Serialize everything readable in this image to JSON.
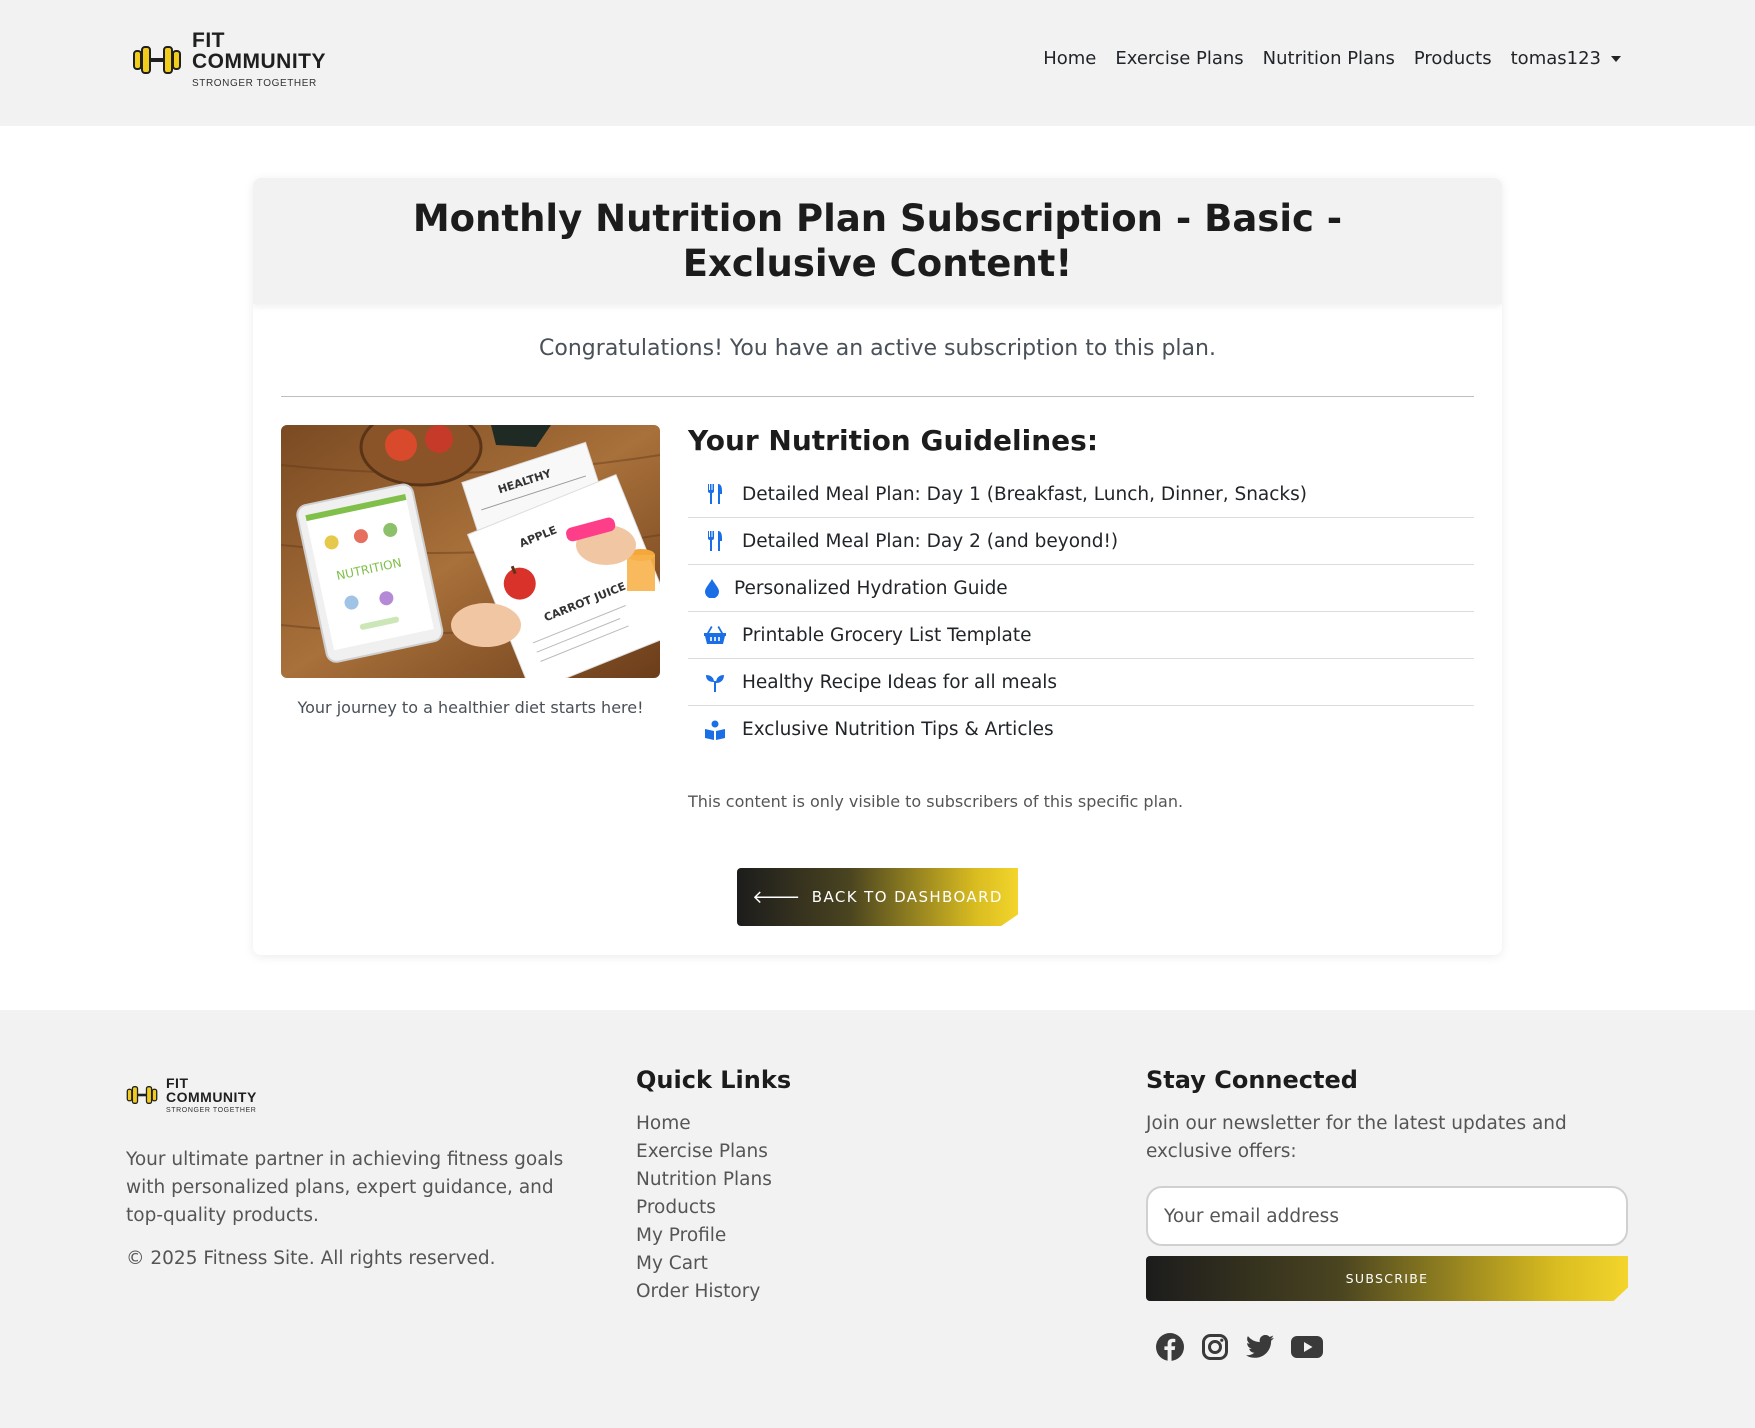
{
  "brand": {
    "line1": "FIT",
    "line2": "COMMUNITY",
    "tagline": "STRONGER TOGETHER",
    "accent": "#f2cc1c"
  },
  "nav": {
    "items": [
      {
        "label": "Home"
      },
      {
        "label": "Exercise Plans"
      },
      {
        "label": "Nutrition Plans"
      },
      {
        "label": "Products"
      }
    ],
    "user": "tomas123"
  },
  "plan": {
    "title": "Monthly Nutrition Plan Subscription - Basic - Exclusive Content!",
    "status_message": "Congratulations! You have an active subscription to this plan.",
    "image_caption": "Your journey to a healthier diet starts here!",
    "guidelines_title": "Your Nutrition Guidelines:",
    "guidelines": [
      {
        "icon": "utensils-icon",
        "label": "Detailed Meal Plan: Day 1 (Breakfast, Lunch, Dinner, Snacks)"
      },
      {
        "icon": "utensils-icon",
        "label": "Detailed Meal Plan: Day 2 (and beyond!)"
      },
      {
        "icon": "droplet-icon",
        "label": "Personalized Hydration Guide"
      },
      {
        "icon": "basket-icon",
        "label": "Printable Grocery List Template"
      },
      {
        "icon": "seedling-icon",
        "label": "Healthy Recipe Ideas for all meals"
      },
      {
        "icon": "book-reader-icon",
        "label": "Exclusive Nutrition Tips & Articles"
      }
    ],
    "note": "This content is only visible to subscribers of this specific plan.",
    "back_button": "BACK TO DASHBOARD",
    "icon_color": "#1a6ee6"
  },
  "image_labels": {
    "healthy": "HEALTHY",
    "nutrition": "NUTRITION",
    "apple": "APPLE",
    "carrot": "CARROT JUICE"
  },
  "footer": {
    "description": "Your ultimate partner in achieving fitness goals with personalized plans, expert guidance, and top-quality products.",
    "copyright": "© 2025 Fitness Site. All rights reserved.",
    "quick_links_title": "Quick Links",
    "quick_links": [
      {
        "label": "Home"
      },
      {
        "label": "Exercise Plans"
      },
      {
        "label": "Nutrition Plans"
      },
      {
        "label": "Products"
      },
      {
        "label": "My Profile"
      },
      {
        "label": "My Cart"
      },
      {
        "label": "Order History"
      }
    ],
    "stay_title": "Stay Connected",
    "newsletter_text": "Join our newsletter for the latest updates and exclusive offers:",
    "email_placeholder": "Your email address",
    "subscribe_label": "SUBSCRIBE",
    "socials": [
      "facebook-icon",
      "instagram-icon",
      "twitter-icon",
      "youtube-icon"
    ]
  }
}
